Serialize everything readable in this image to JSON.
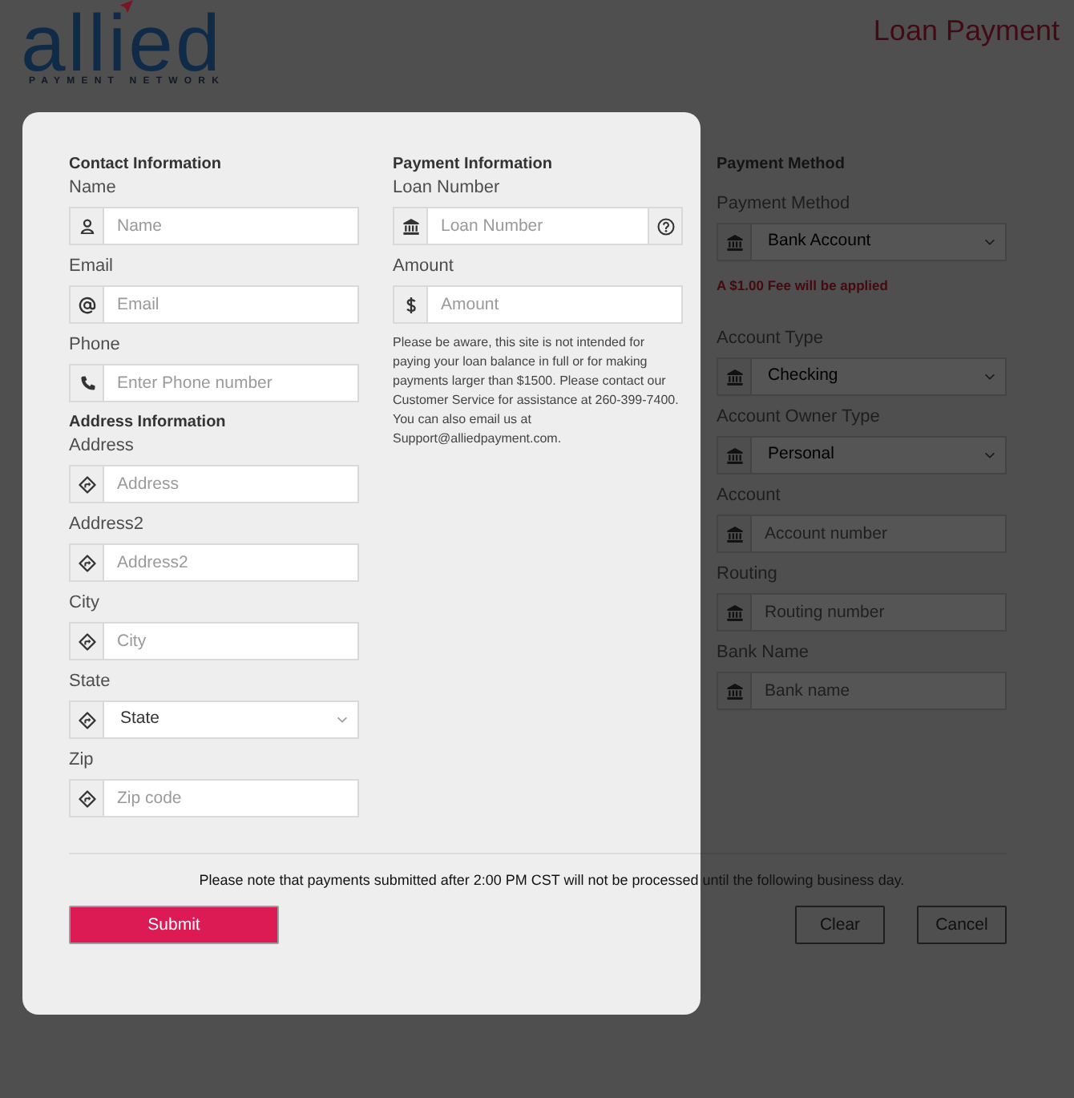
{
  "header": {
    "logo": {
      "wordmark": "allied",
      "tagline": "PAYMENT NETWORK"
    },
    "title": "Loan Payment"
  },
  "columns": [
    {
      "highlighted": true,
      "items": [
        {
          "kind": "heading",
          "text": "Contact Information"
        },
        {
          "kind": "input",
          "label": "Name",
          "placeholder": "Name"
        },
        {
          "kind": "input",
          "label": "Email",
          "placeholder": "Email"
        },
        {
          "kind": "input",
          "label": "Phone",
          "placeholder": "Enter Phone number"
        },
        {
          "kind": "heading",
          "text": "Address Information"
        },
        {
          "kind": "input",
          "label": "Address",
          "placeholder": "Address"
        },
        {
          "kind": "input",
          "label": "Address2",
          "placeholder": "Address2"
        },
        {
          "kind": "input",
          "label": "City",
          "placeholder": "City"
        },
        {
          "kind": "select",
          "label": "State",
          "value": "State"
        },
        {
          "kind": "input",
          "label": "Zip",
          "placeholder": "Zip code"
        }
      ]
    },
    {
      "highlighted": true,
      "items": [
        {
          "kind": "heading",
          "text": "Payment Information"
        },
        {
          "kind": "input",
          "label": "Loan Number",
          "placeholder": "Loan Number",
          "help": true
        },
        {
          "kind": "input",
          "label": "Amount",
          "placeholder": "Amount"
        },
        {
          "kind": "note",
          "text": "Please be aware, this site is not intended for paying your loan balance in full or for making payments larger than $1500. Please contact our Customer Service for assistance at 260-399-7400. You can also email us at Support@alliedpayment.com."
        }
      ]
    },
    {
      "highlighted": false,
      "items": [
        {
          "kind": "heading",
          "text": "Payment Method"
        },
        {
          "kind": "select",
          "label": "Payment Method",
          "value": "Bank Account"
        },
        {
          "kind": "fee",
          "text": "A $1.00 Fee will be applied"
        },
        {
          "kind": "select",
          "label": "Account Type",
          "value": "Checking"
        },
        {
          "kind": "select",
          "label": "Account Owner Type",
          "value": "Personal"
        },
        {
          "kind": "input",
          "label": "Account",
          "placeholder": "Account number"
        },
        {
          "kind": "input",
          "label": "Routing",
          "placeholder": "Routing number"
        },
        {
          "kind": "input",
          "label": "Bank Name",
          "placeholder": "Bank name"
        }
      ]
    }
  ],
  "footer": {
    "note": "Please note that payments submitted after 2:00 PM CST will not be processed until the following business day.",
    "buttons": [
      {
        "label": "Submit",
        "kind": "primary",
        "highlighted": true
      },
      {
        "label": "Clear",
        "kind": "secondary",
        "highlighted": false
      },
      {
        "label": "Cancel",
        "kind": "secondary",
        "highlighted": false
      }
    ]
  }
}
